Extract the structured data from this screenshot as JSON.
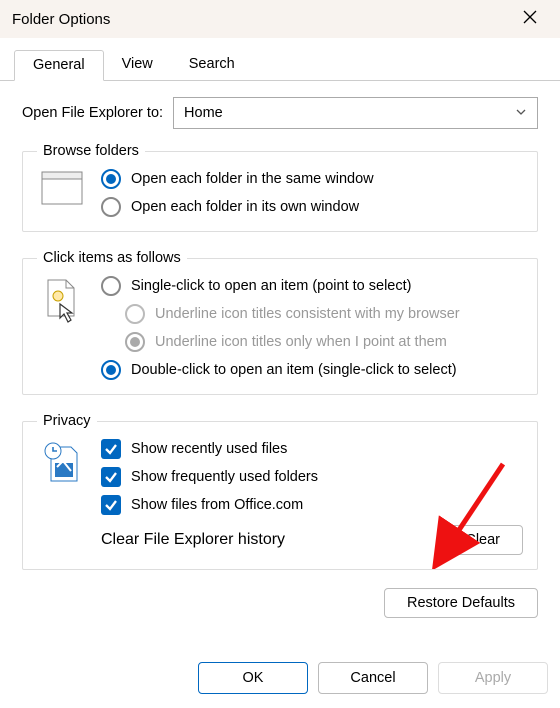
{
  "title": "Folder Options",
  "tabs": {
    "general": "General",
    "view": "View",
    "search": "Search"
  },
  "open_label": "Open File Explorer to:",
  "open_value": "Home",
  "browse": {
    "legend": "Browse folders",
    "same": "Open each folder in the same window",
    "own": "Open each folder in its own window"
  },
  "click": {
    "legend": "Click items as follows",
    "single": "Single-click to open an item (point to select)",
    "underline_browser": "Underline icon titles consistent with my browser",
    "underline_point": "Underline icon titles only when I point at them",
    "double": "Double-click to open an item (single-click to select)"
  },
  "privacy": {
    "legend": "Privacy",
    "recent": "Show recently used files",
    "frequent": "Show frequently used folders",
    "office": "Show files from Office.com",
    "clear_label": "Clear File Explorer history",
    "clear_btn": "Clear"
  },
  "restore": "Restore Defaults",
  "ok": "OK",
  "cancel": "Cancel",
  "apply": "Apply"
}
